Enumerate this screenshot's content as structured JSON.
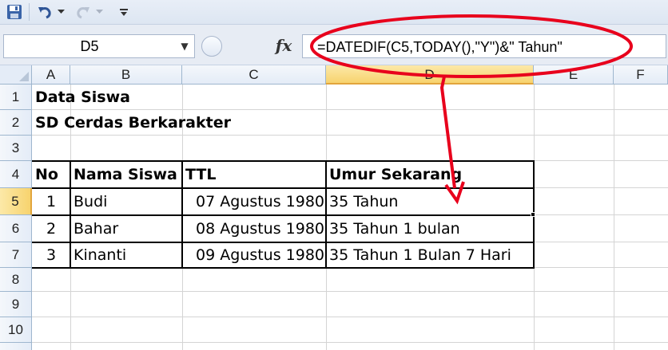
{
  "toolbar": {
    "icons": [
      "save-icon",
      "undo-icon",
      "dropdown-icon",
      "redo-icon",
      "dropdown-icon",
      "customize-icon"
    ]
  },
  "formula_bar": {
    "name_box": "D5",
    "fx_label": "fx",
    "formula": "=DATEDIF(C5,TODAY(),\"Y\")&\" Tahun\""
  },
  "columns": [
    "A",
    "B",
    "C",
    "D",
    "E",
    "F"
  ],
  "active_column": "D",
  "rows": [
    "1",
    "2",
    "3",
    "4",
    "5",
    "6",
    "7",
    "8",
    "9",
    "10"
  ],
  "active_row": "5",
  "sheet": {
    "title": "Data Siswa",
    "school": "SD Cerdas Berkarakter",
    "headers": [
      "No",
      "Nama Siswa",
      "TTL",
      "Umur Sekarang"
    ],
    "records": [
      {
        "no": "1",
        "nama": "Budi",
        "ttl": "07 Agustus 1980",
        "umur": "35 Tahun"
      },
      {
        "no": "2",
        "nama": "Bahar",
        "ttl": "08 Agustus 1980",
        "umur": "35 Tahun 1 bulan"
      },
      {
        "no": "3",
        "nama": "Kinanti",
        "ttl": "09 Agustus 1980",
        "umur": "35 Tahun 1 Bulan 7 Hari"
      }
    ]
  },
  "annotation": {
    "color": "#e8001c"
  }
}
